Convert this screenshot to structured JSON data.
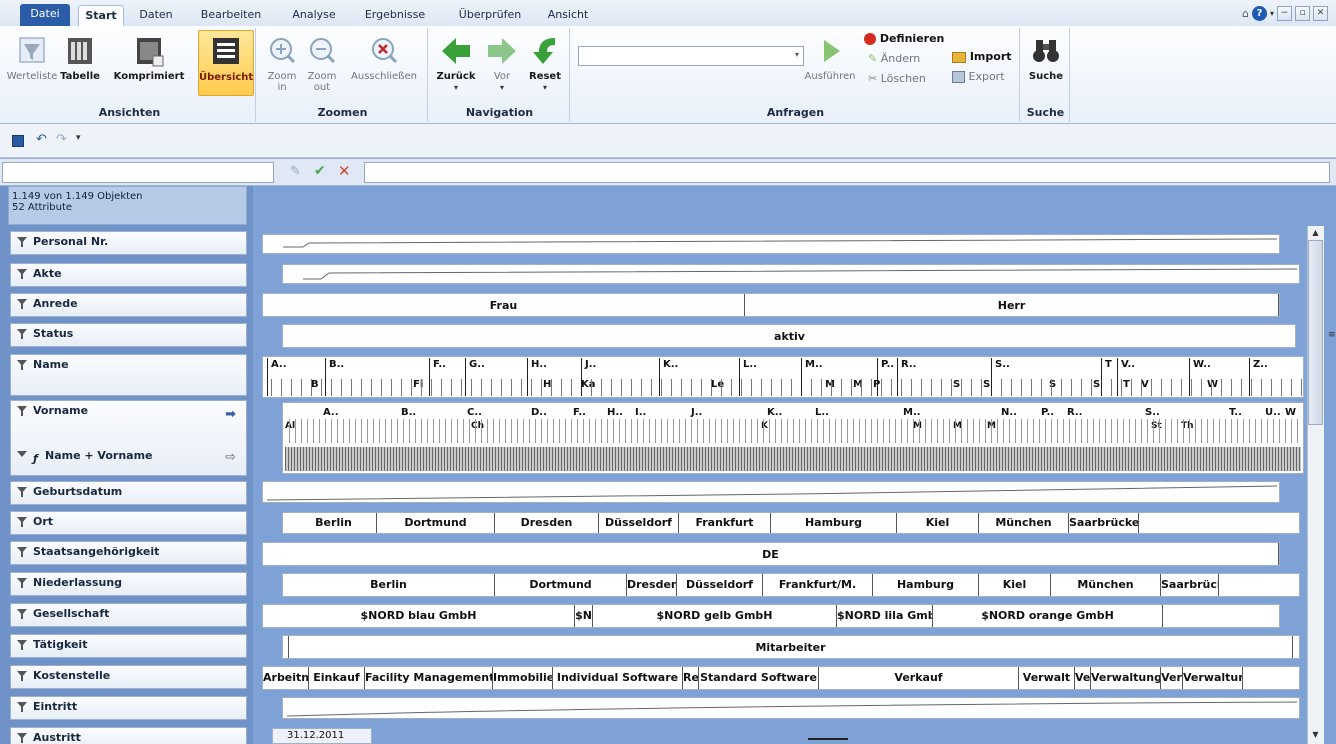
{
  "tabs": [
    "Datei",
    "Start",
    "Daten",
    "Bearbeiten",
    "Analyse",
    "Ergebnisse",
    "Überprüfen",
    "Ansicht"
  ],
  "active_tab": "Start",
  "window_controls": [
    "−",
    "▫",
    "✕"
  ],
  "ribbon": {
    "ansichten": {
      "label": "Ansichten",
      "buttons": [
        "Werteliste",
        "Tabelle",
        "Komprimiert",
        "Übersicht"
      ]
    },
    "zoomen": {
      "label": "Zoomen",
      "zoom_in": "Zoom in",
      "zoom_in_1": "Zoom",
      "zoom_in_2": "in",
      "zoom_out_1": "Zoom",
      "zoom_out_2": "out",
      "exclude": "Ausschließen"
    },
    "navigation": {
      "label": "Navigation",
      "buttons": [
        "Zurück",
        "Vor",
        "Reset"
      ]
    },
    "anfragen": {
      "label": "Anfragen",
      "run": "Ausführen",
      "define": "Definieren",
      "change": "Ändern",
      "delete": "Löschen",
      "import": "Import",
      "export": "Export"
    },
    "suche": {
      "label": "Suche",
      "button": "Suche"
    }
  },
  "formula": {
    "value": ""
  },
  "summary": {
    "objects": "1.149 von 1.149 Objekten",
    "attributes": "52 Attribute"
  },
  "attributes": [
    {
      "label": "Personal Nr."
    },
    {
      "label": "Akte"
    },
    {
      "label": "Anrede",
      "segments": [
        "Frau",
        "Herr"
      ]
    },
    {
      "label": "Status",
      "segments": [
        "aktiv"
      ]
    },
    {
      "label": "Name",
      "segments": [
        "A..",
        "B..",
        "F..",
        "G..",
        "H..",
        "J..",
        "K..",
        "L..",
        "M..",
        "P..",
        "R..",
        "S..",
        "T",
        "V..",
        "W..",
        "Z.."
      ]
    },
    {
      "label": "Vorname",
      "segments": [
        "A..",
        "B..",
        "C..",
        "D..",
        "F..",
        "H..",
        "I..",
        "J..",
        "K..",
        "L..",
        "M..",
        "N..",
        "P..",
        "R..",
        "S..",
        "T..",
        "U..",
        "W"
      ]
    },
    {
      "label": "Name + Vorname"
    },
    {
      "label": "Geburtsdatum"
    },
    {
      "label": "Ort",
      "segments": [
        "Berlin",
        "Dortmund",
        "Dresden",
        "Düsseldorf",
        "Frankfurt",
        "Hamburg",
        "Kiel",
        "München",
        "Saarbrücke"
      ]
    },
    {
      "label": "Staatsangehörigkeit",
      "segments": [
        "DE"
      ]
    },
    {
      "label": "Niederlassung",
      "segments": [
        "Berlin",
        "Dortmund",
        "Dresden",
        "Düsseldorf",
        "Frankfurt/M.",
        "Hamburg",
        "Kiel",
        "München",
        "Saarbrück"
      ]
    },
    {
      "label": "Gesellschaft",
      "segments": [
        "$NORD blau GmbH",
        "$N",
        "$NORD gelb GmbH",
        "$NORD lila Gmb",
        "$NORD orange GmbH"
      ]
    },
    {
      "label": "Tätigkeit",
      "segments": [
        "Mitarbeiter"
      ]
    },
    {
      "label": "Kostenstelle",
      "segments": [
        "Arbeitnel",
        "Einkauf",
        "Facility Management",
        "Immobilie",
        "Individual Software",
        "Re",
        "Standard Software",
        "Verkauf",
        "Verwalt",
        "Ve",
        "Verwaltung",
        "Ver",
        "Verwaltur"
      ]
    },
    {
      "label": "Eintritt"
    },
    {
      "label": "Austritt",
      "segments": [
        "31.12.2011"
      ]
    }
  ],
  "name_subrow": [
    "B",
    "Fi",
    "H",
    "Ka",
    "Le",
    "M",
    "M",
    "P",
    "S",
    "S",
    "S",
    "S",
    "T",
    "V",
    "W"
  ],
  "vorname_subrow": [
    "Al",
    "Ch",
    "K",
    "M",
    "M",
    "M",
    "St",
    "Th"
  ]
}
